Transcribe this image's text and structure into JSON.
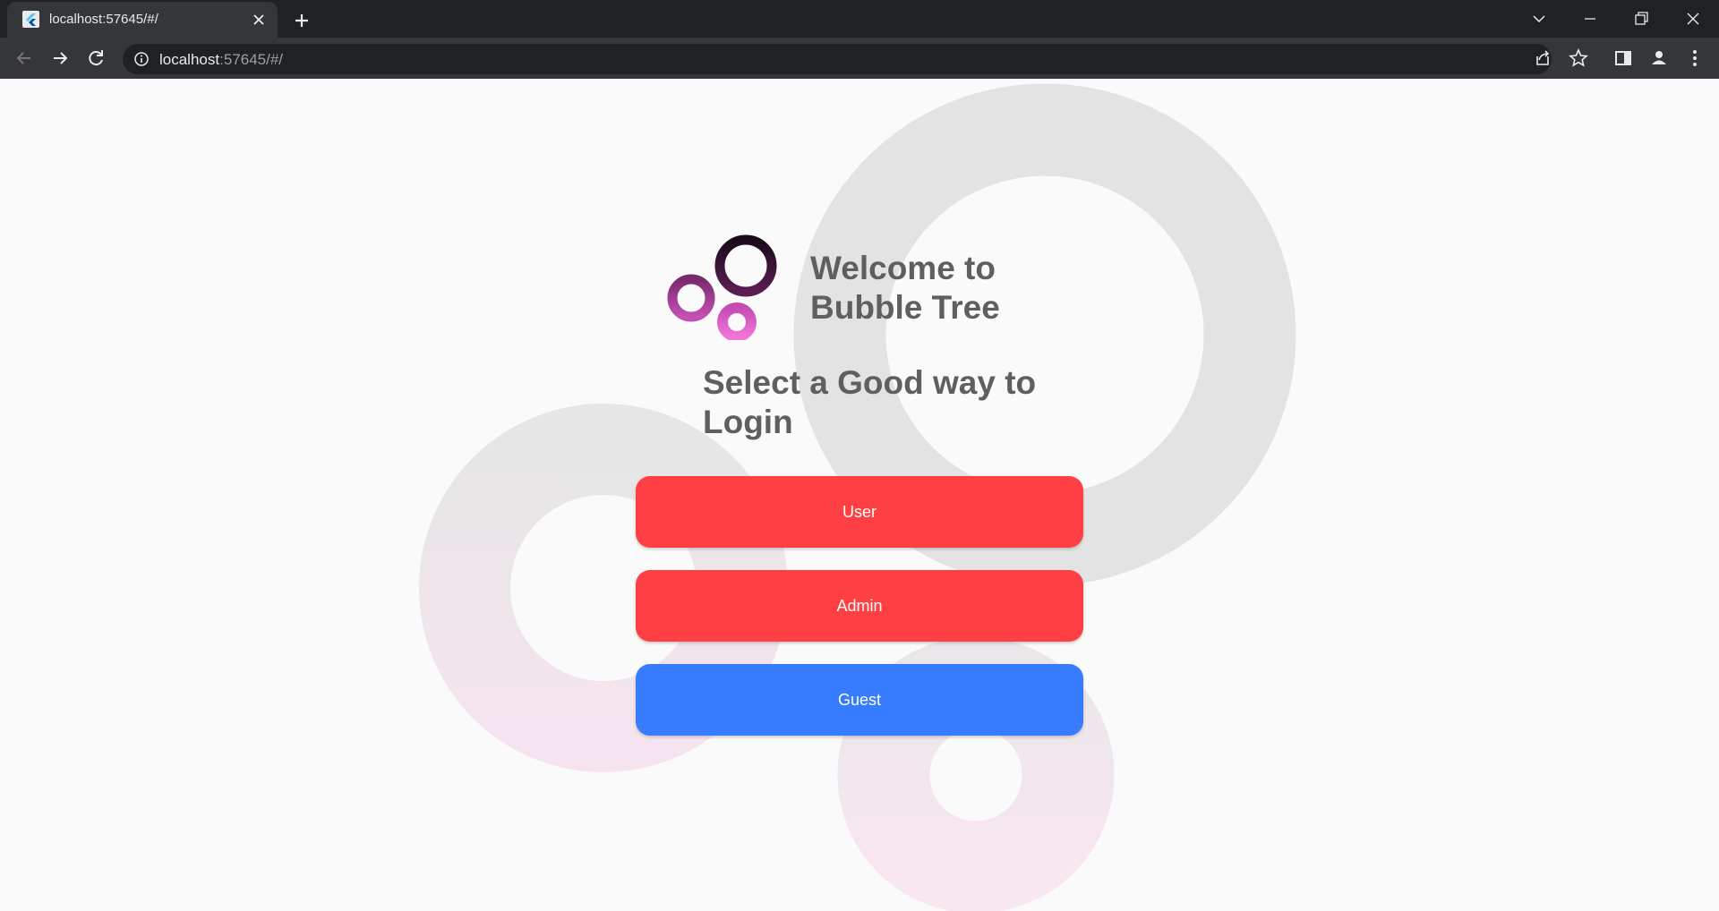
{
  "browser": {
    "tab_title": "localhost:57645/#/",
    "url_host": "localhost",
    "url_rest": ":57645/#/"
  },
  "page": {
    "welcome_line1": "Welcome to",
    "welcome_line2": "Bubble Tree",
    "select_line1": "Select a Good way to",
    "select_line2": "Login",
    "buttons": {
      "user": "User",
      "admin": "Admin",
      "guest": "Guest"
    }
  },
  "colors": {
    "user_button": "#fe4044",
    "admin_button": "#fe4044",
    "guest_button": "#377cfe",
    "heading_text": "#5f5f5f",
    "background": "#fafafa"
  },
  "icons": [
    "flutter-favicon-icon",
    "close-icon",
    "plus-icon",
    "chevron-down-icon",
    "minimize-icon",
    "restore-icon",
    "close-window-icon",
    "back-arrow-icon",
    "forward-arrow-icon",
    "reload-icon",
    "info-icon",
    "share-icon",
    "star-icon",
    "side-panel-icon",
    "profile-icon",
    "more-vert-icon",
    "bubble-logo-icon"
  ]
}
